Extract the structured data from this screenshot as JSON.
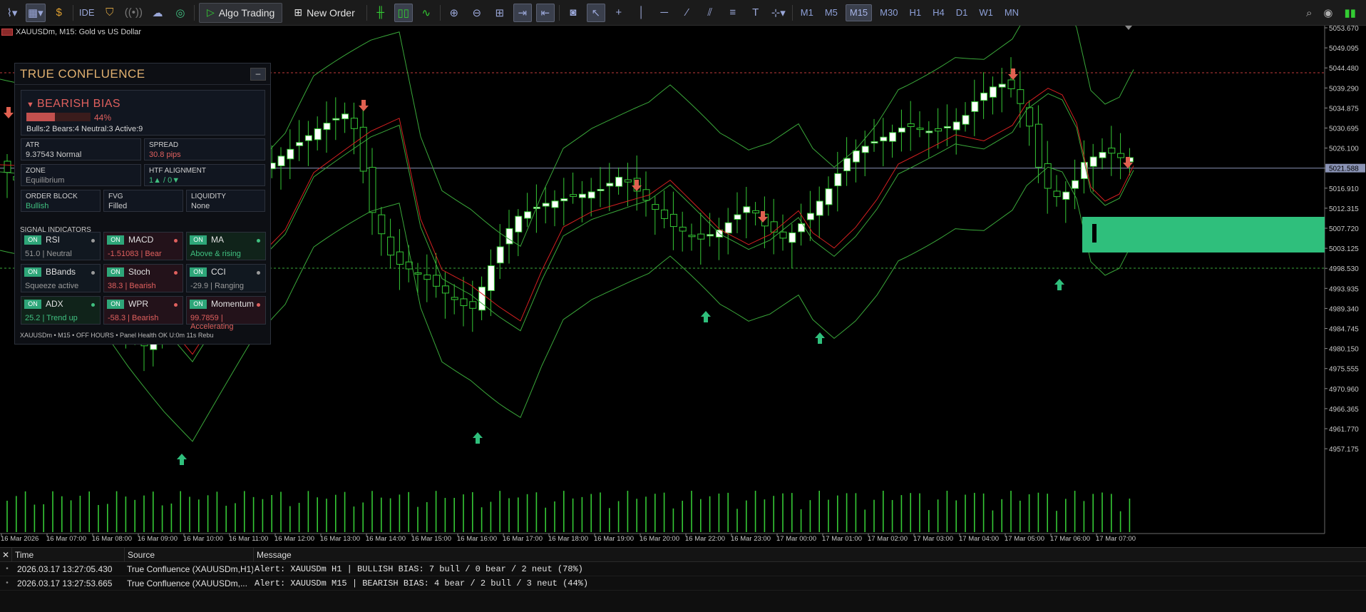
{
  "toolbar": {
    "algo_label": "Algo Trading",
    "neworder_label": "New Order",
    "ide_label": "IDE",
    "timeframes": [
      "M1",
      "M5",
      "M15",
      "M30",
      "H1",
      "H4",
      "D1",
      "W1",
      "MN"
    ],
    "active_timeframe": "M15"
  },
  "chart": {
    "symbol": "XAUUSDm, M15:  Gold vs US Dollar",
    "current_price": "5021.588",
    "price_ticks": [
      "5053.670",
      "5049.095",
      "5044.480",
      "5039.290",
      "5034.875",
      "5030.695",
      "5026.100",
      "5021.588",
      "5016.910",
      "5012.315",
      "5007.720",
      "5003.125",
      "4998.530",
      "4993.935",
      "4989.340",
      "4984.745",
      "4980.150",
      "4975.555",
      "4970.960",
      "4966.365",
      "4961.770",
      "4957.175"
    ],
    "time_ticks": [
      "16 Mar 2026",
      "16 Mar 07:00",
      "16 Mar 08:00",
      "16 Mar 09:00",
      "16 Mar 10:00",
      "16 Mar 11:00",
      "16 Mar 12:00",
      "16 Mar 13:00",
      "16 Mar 14:00",
      "16 Mar 15:00",
      "16 Mar 16:00",
      "16 Mar 17:00",
      "16 Mar 18:00",
      "16 Mar 19:00",
      "16 Mar 20:00",
      "16 Mar 22:00",
      "16 Mar 23:00",
      "17 Mar 00:00",
      "17 Mar 01:00",
      "17 Mar 02:00",
      "17 Mar 03:00",
      "17 Mar 04:00",
      "17 Mar 05:00",
      "17 Mar 06:00",
      "17 Mar 07:00"
    ],
    "colors": {
      "bull": "#ffffff",
      "wick": "#35c935",
      "ma_red": "#d42020",
      "band": "#3aa83a",
      "zone": "#2fbf7c"
    }
  },
  "panel": {
    "title": "TRUE CONFLUENCE",
    "minimize": "–",
    "bias_label": "BEARISH BIAS",
    "bias_pct": "44%",
    "bias_fraction": 0.44,
    "counts": "Bulls:2  Bears:4  Neutral:3  Active:9",
    "atr_label": "ATR",
    "atr_value": "9.37543  Normal",
    "spread_label": "SPREAD",
    "spread_value": "30.8 pips",
    "zone_label": "ZONE",
    "zone_value": "Equilibrium",
    "htf_label": "HTF ALIGNMENT",
    "htf_value": "1▲ / 0▼",
    "ob_label": "ORDER BLOCK",
    "ob_value": "Bullish",
    "fvg_label": "FVG",
    "fvg_value": "Filled",
    "liq_label": "LIQUIDITY",
    "liq_value": "None",
    "signals_label": "SIGNAL INDICATORS",
    "indicators": [
      {
        "on": "ON",
        "name": "RSI",
        "value": "51.0 | Neutral",
        "state": "neutral"
      },
      {
        "on": "ON",
        "name": "MACD",
        "value": "-1.51083 | Bear",
        "state": "bear"
      },
      {
        "on": "ON",
        "name": "MA",
        "value": "Above & rising",
        "state": "bull"
      },
      {
        "on": "ON",
        "name": "BBands",
        "value": "Squeeze active",
        "state": "neutral"
      },
      {
        "on": "ON",
        "name": "Stoch",
        "value": "38.3 | Bearish",
        "state": "bear"
      },
      {
        "on": "ON",
        "name": "CCI",
        "value": "-29.9 | Ranging",
        "state": "neutral"
      },
      {
        "on": "ON",
        "name": "ADX",
        "value": "25.2 | Trend up",
        "state": "bull"
      },
      {
        "on": "ON",
        "name": "WPR",
        "value": "-58.3 | Bearish",
        "state": "bear"
      },
      {
        "on": "ON",
        "name": "Momentum",
        "value": "99.7859 | Accelerating",
        "state": "bear"
      }
    ],
    "footer": "XAUUSDm • M15 • OFF HOURS • Panel Health OK U:0m 11s Rebu"
  },
  "alerts": {
    "close": "✕",
    "headers": [
      "Time",
      "Source",
      "Message"
    ],
    "rows": [
      {
        "time": "2026.03.17 13:27:05.430",
        "source": "True Confluence (XAUUSDm,H1)",
        "message": "Alert: XAUUSDm H1 | BULLISH BIAS: 7 bull / 0 bear / 2 neut  (78%)"
      },
      {
        "time": "2026.03.17 13:27:53.665",
        "source": "True Confluence (XAUUSDm,...",
        "message": "Alert: XAUUSDm M15 | BEARISH BIAS: 4 bear / 2 bull / 3 neut  (44%)"
      }
    ]
  }
}
